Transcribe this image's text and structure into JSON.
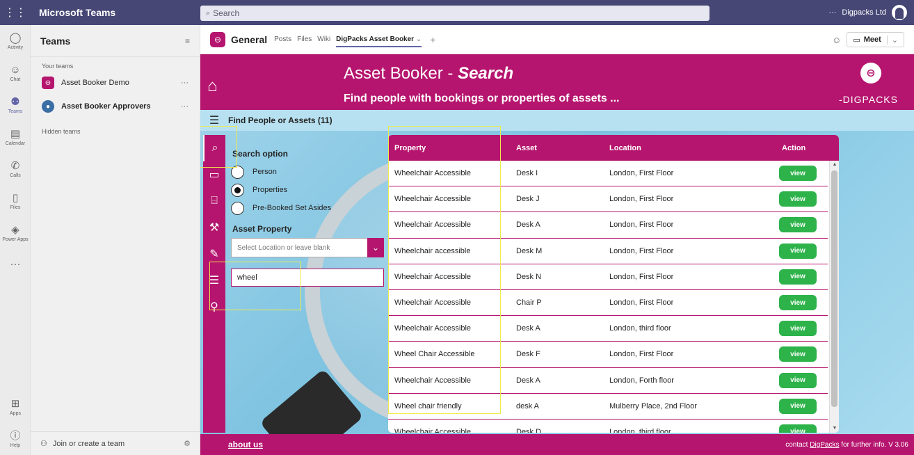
{
  "topbar": {
    "app_name": "Microsoft Teams",
    "search_placeholder": "Search",
    "ellipsis": "···",
    "org_name": "Digpacks Ltd"
  },
  "rail": {
    "items": [
      {
        "label": "Activity",
        "icon": "bell-icon",
        "glyph": "🔔"
      },
      {
        "label": "Chat",
        "icon": "chat-icon",
        "glyph": "💬"
      },
      {
        "label": "Teams",
        "icon": "teams-icon",
        "glyph": "👥"
      },
      {
        "label": "Calendar",
        "icon": "calendar-icon",
        "glyph": "📅"
      },
      {
        "label": "Calls",
        "icon": "phone-icon",
        "glyph": "📞"
      },
      {
        "label": "Files",
        "icon": "file-icon",
        "glyph": "📄"
      },
      {
        "label": "Power Apps",
        "icon": "power-apps-icon",
        "glyph": "◈"
      },
      {
        "label": "",
        "icon": "more-icon",
        "glyph": "···"
      }
    ],
    "bottom": [
      {
        "label": "Apps",
        "icon": "apps-icon",
        "glyph": "⊞"
      },
      {
        "label": "Help",
        "icon": "help-icon",
        "glyph": "?"
      }
    ]
  },
  "teams_pane": {
    "title": "Teams",
    "your_teams_label": "Your teams",
    "teams": [
      {
        "name": "Asset Booker Demo",
        "bold": false
      },
      {
        "name": "Asset Booker Approvers",
        "bold": true
      }
    ],
    "hidden_label": "Hidden teams",
    "join_label": "Join or create a team",
    "more": "···"
  },
  "channel": {
    "title": "General",
    "tabs": [
      "Posts",
      "Files",
      "Wiki"
    ],
    "active_tab": "DigPacks Asset Booker",
    "meet_label": "Meet"
  },
  "app": {
    "title_main": "Asset Booker - ",
    "title_em": "Search",
    "subtitle": "Find people with bookings or properties of assets ...",
    "brand": "DIGPACKS",
    "find_heading": "Find People or Assets (11)",
    "search_option_label": "Search option",
    "options": [
      {
        "label": "Person",
        "selected": false
      },
      {
        "label": "Properties",
        "selected": true
      },
      {
        "label": "Pre-Booked Set Asides",
        "selected": false
      }
    ],
    "asset_property_label": "Asset Property",
    "location_placeholder": "Select Location or leave blank",
    "search_text": "wheel",
    "columns": [
      "Property",
      "Asset",
      "Location",
      "Action"
    ],
    "rows": [
      {
        "property": "Wheelchair Accessible",
        "asset": "Desk I",
        "location": "London, First Floor",
        "action": "view"
      },
      {
        "property": "Wheelchair Accessible",
        "asset": "Desk J",
        "location": "London, First Floor",
        "action": "view"
      },
      {
        "property": "Wheelchair Accessible",
        "asset": "Desk A",
        "location": "London, First Floor",
        "action": "view"
      },
      {
        "property": "Wheelchair accessible",
        "asset": "Desk M",
        "location": "London, First Floor",
        "action": "view"
      },
      {
        "property": "Wheelchair Accessible",
        "asset": "Desk N",
        "location": "London, First Floor",
        "action": "view"
      },
      {
        "property": "Wheelchair Accessible",
        "asset": "Chair P",
        "location": "London, First Floor",
        "action": "view"
      },
      {
        "property": "Wheelchair Accessible",
        "asset": "Desk A",
        "location": "London, third floor",
        "action": "view"
      },
      {
        "property": "Wheel Chair Accessible",
        "asset": "Desk F",
        "location": "London, First Floor",
        "action": "view"
      },
      {
        "property": "Wheelchair Accessible",
        "asset": "Desk A",
        "location": "London, Forth floor",
        "action": "view"
      },
      {
        "property": "Wheel chair friendly",
        "asset": "desk A",
        "location": "Mulberry Place, 2nd Floor",
        "action": "view"
      },
      {
        "property": "Wheelchair Accessible",
        "asset": "Desk D",
        "location": "London, third floor",
        "action": "view"
      }
    ],
    "footer_about": "about us",
    "footer_contact_pre": "contact ",
    "footer_contact_link": "DigPacks",
    "footer_contact_post": " for further info. V 3.06"
  },
  "colors": {
    "brand": "#b5156e",
    "teams_purple": "#464775",
    "view_green": "#2db34a",
    "highlight": "#f2ea4a"
  }
}
